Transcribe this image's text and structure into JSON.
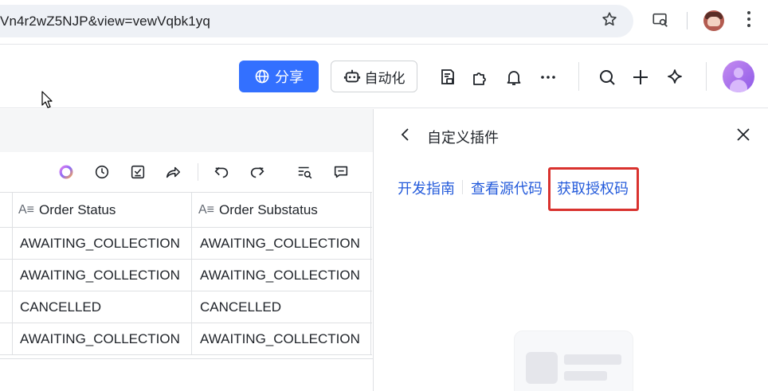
{
  "browser": {
    "url": "Vn4r2wZ5NJP&view=vewVqbk1yq",
    "icons": [
      "star-icon",
      "search-in-page-icon",
      "profile-avatar",
      "more-vert-icon"
    ]
  },
  "toolbar": {
    "share_label": "分享",
    "automation_label": "自动化",
    "share_color": "#3370ff",
    "icons": [
      "form-icon",
      "plugin-icon",
      "bell-icon",
      "more-icon",
      "search-icon",
      "plus-icon",
      "sparkle-icon"
    ]
  },
  "table_toolbar": {
    "icons": [
      "ai-ring-icon",
      "history-icon",
      "checklist-icon",
      "share-arrow-icon",
      "undo-icon",
      "redo-icon",
      "find-icon",
      "comment-icon"
    ]
  },
  "table": {
    "columns": [
      {
        "label": "Order Status"
      },
      {
        "label": "Order Substatus"
      }
    ],
    "rows": [
      [
        "AWAITING_COLLECTION",
        "AWAITING_COLLECTION"
      ],
      [
        "AWAITING_COLLECTION",
        "AWAITING_COLLECTION"
      ],
      [
        "CANCELLED",
        "CANCELLED"
      ],
      [
        "AWAITING_COLLECTION",
        "AWAITING_COLLECTION"
      ]
    ]
  },
  "panel": {
    "title": "自定义插件",
    "links": [
      "开发指南",
      "查看源代码",
      "获取授权码"
    ],
    "link_color": "#245bdb",
    "highlight_color": "#d9322e"
  }
}
